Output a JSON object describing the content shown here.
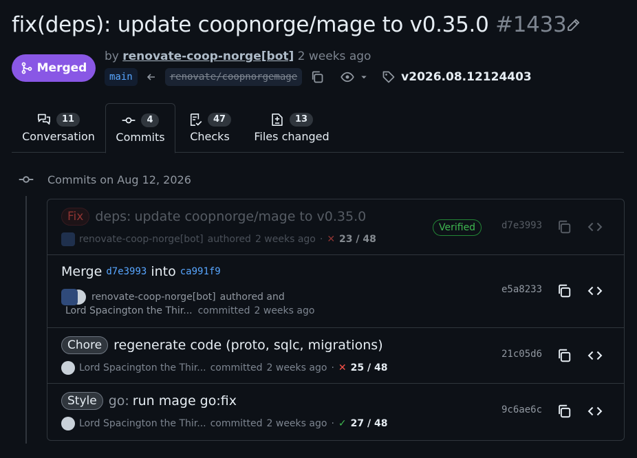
{
  "pr": {
    "title": "fix(deps): update coopnorge/mage to v0.35.0",
    "number": "#1433",
    "state": "Merged",
    "by": "by",
    "author": "renovate-coop-norge[bot]",
    "time": "2 weeks ago",
    "base_branch": "main",
    "head_branch": "renovate/coopnorgemage",
    "tag": "v2026.08.12124403"
  },
  "tabs": [
    {
      "label": "Conversation",
      "count": "11"
    },
    {
      "label": "Commits",
      "count": "4"
    },
    {
      "label": "Checks",
      "count": "47"
    },
    {
      "label": "Files changed",
      "count": "13"
    }
  ],
  "timeline": {
    "date_heading": "Commits on Aug 12, 2026"
  },
  "commits": [
    {
      "label": "Fix",
      "message_prefix": "deps:",
      "message": "update coopnorge/mage to v0.35.0",
      "author": "renovate-coop-norge[bot]",
      "action": "authored",
      "time": "2 weeks ago",
      "status_mark": "✕",
      "checks": "23 / 48",
      "verified": "Verified",
      "sha": "d7e3993"
    },
    {
      "message_word1": "Merge",
      "sha_a": "d7e3993",
      "message_word2": "into",
      "sha_b": "ca991f9",
      "author": "renovate-coop-norge[bot]",
      "action": "authored and",
      "committer": "Lord Spacington the Thir...",
      "action2": "committed",
      "time": "2 weeks ago",
      "sha": "e5a8233"
    },
    {
      "label": "Chore",
      "message": "regenerate code (proto, sqlc, migrations)",
      "author": "Lord Spacington the Thir...",
      "action": "committed",
      "time": "2 weeks ago",
      "status_mark": "✕",
      "checks": "25 / 48",
      "sha": "21c05d6"
    },
    {
      "label": "Style",
      "message_prefix": "go:",
      "message": "run mage go:fix",
      "author": "Lord Spacington the Thir...",
      "action": "committed",
      "time": "2 weeks ago",
      "status_mark": "✓",
      "checks": "27 / 48",
      "sha": "9c6ae6c"
    }
  ],
  "colors": {
    "merged": "#8957e5",
    "link": "#58a6ff",
    "fail": "#f85149",
    "success": "#3fb950"
  }
}
